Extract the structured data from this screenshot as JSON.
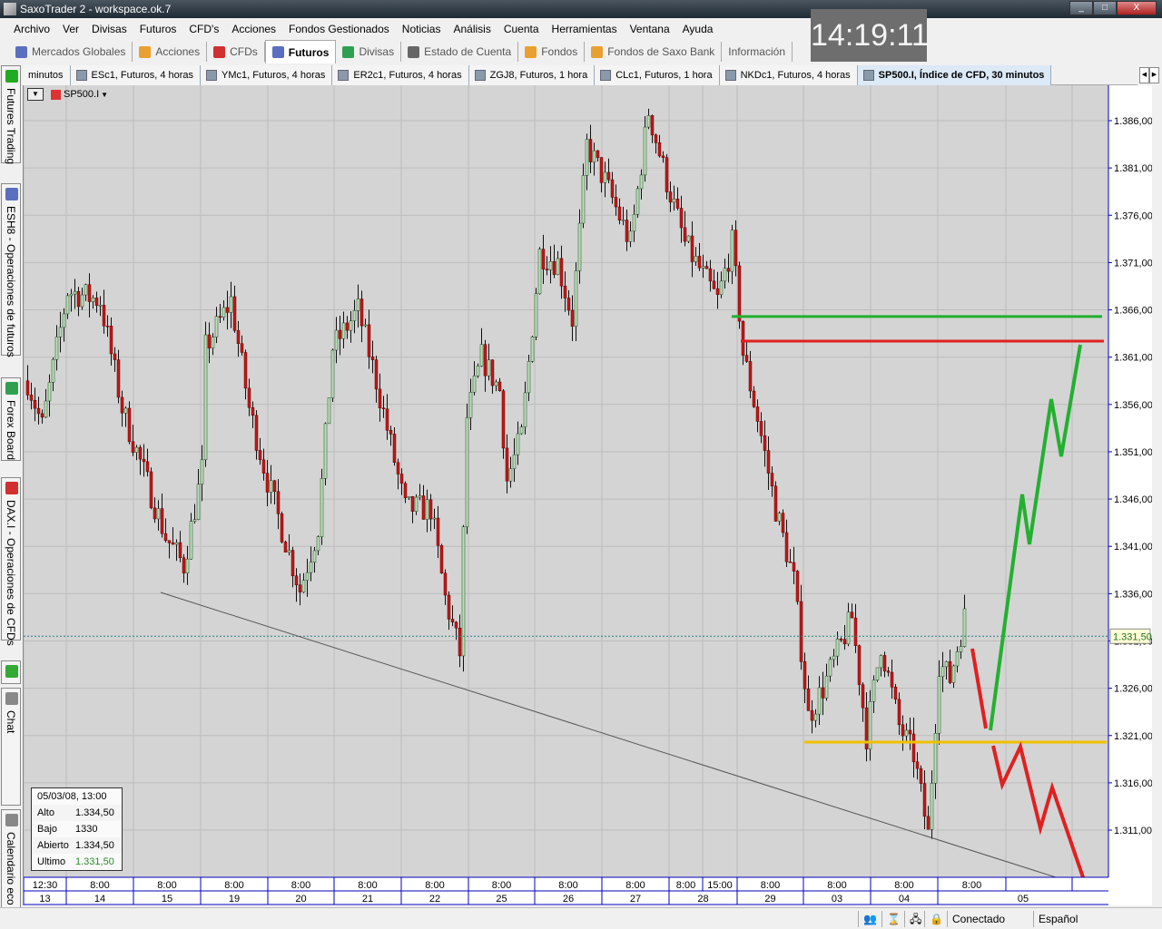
{
  "window": {
    "title": "SaxoTrader 2 - workspace.ok.7",
    "minimize": "_",
    "maximize": "□",
    "close": "X"
  },
  "menu": [
    "Archivo",
    "Ver",
    "Divisas",
    "Futuros",
    "CFD's",
    "Acciones",
    "Fondos Gestionados",
    "Noticias",
    "Análisis",
    "Cuenta",
    "Herramientas",
    "Ventana",
    "Ayuda"
  ],
  "toolbar": [
    {
      "label": "Mercados Globales",
      "color": "#5a6fc0"
    },
    {
      "label": "Acciones",
      "color": "#e8a030"
    },
    {
      "label": "CFDs",
      "color": "#d03030"
    },
    {
      "label": "Futuros",
      "color": "#5a6fc0",
      "active": true
    },
    {
      "label": "Divisas",
      "color": "#30a050"
    },
    {
      "label": "Estado de Cuenta",
      "color": "#666"
    },
    {
      "label": "Fondos",
      "color": "#e8a030"
    },
    {
      "label": "Fondos de Saxo Bank",
      "color": "#e8a030"
    },
    {
      "label": "Información",
      "color": ""
    }
  ],
  "clock": "14:19:11",
  "tabs": [
    "minutos",
    "ESc1, Futuros, 4 horas",
    "YMc1, Futuros, 4 horas",
    "ER2c1, Futuros, 4 horas",
    "ZGJ8, Futuros, 1 hora",
    "CLc1, Futuros, 1 hora",
    "NKDc1, Futuros, 4 horas",
    "SP500.I, Índice de CFD, 30 minutos"
  ],
  "active_tab": 7,
  "sidebar": [
    {
      "label": "Futures Trading",
      "icon": "up-down-arrows-icon",
      "color": "#2a2"
    },
    {
      "label": "ESH8 - Operaciones de futuros",
      "icon": "futures-icon",
      "color": "#5a6fc0"
    },
    {
      "label": "Forex Board",
      "icon": "forex-icon",
      "color": "#30a050"
    },
    {
      "label": "DAX.I - Operaciones de CFDs",
      "icon": "cfd-icon",
      "color": "#d03030"
    },
    {
      "label": "",
      "icon": "chart-icon",
      "color": "#3a3"
    },
    {
      "label": "Chat",
      "icon": "chat-icon",
      "color": "#888"
    },
    {
      "label": "Calendario eco",
      "icon": "calendar-icon",
      "color": "#888"
    }
  ],
  "chart": {
    "symbol": "SP500.I",
    "info": {
      "date": "05/03/08, 13:00",
      "rows": [
        {
          "k": "Alto",
          "v": "1.334,50"
        },
        {
          "k": "Bajo",
          "v": "1330"
        },
        {
          "k": "Abierto",
          "v": "1.334,50"
        },
        {
          "k": "Ultimo",
          "v": "1.331,50"
        }
      ]
    },
    "last_price_label": "1.331,50",
    "colors": {
      "up": "#b8e0b8",
      "down": "#c01818",
      "green_line": "#22b030",
      "red_line": "#e02020",
      "orange_line": "#f0c000"
    }
  },
  "chart_data": {
    "type": "candlestick",
    "ylim": [
      1306,
      1390
    ],
    "yticks": [
      "1.386,00",
      "1.381,00",
      "1.376,00",
      "1.371,00",
      "1.366,00",
      "1.361,00",
      "1.356,00",
      "1.351,00",
      "1.346,00",
      "1.341,00",
      "1.336,00",
      "1.331,00",
      "1.326,00",
      "1.321,00",
      "1.316,00",
      "1.311,00"
    ],
    "ytick_values": [
      1386,
      1381,
      1376,
      1371,
      1366,
      1361,
      1356,
      1351,
      1346,
      1341,
      1336,
      1331,
      1326,
      1321,
      1316,
      1311
    ],
    "last_price": 1331.5,
    "levels": {
      "green": 1365.3,
      "red": 1362.7,
      "orange": 1320.3
    },
    "close_path": [
      [
        0,
        1358.5
      ],
      [
        4,
        1353.7
      ],
      [
        11,
        1368
      ],
      [
        20,
        1367
      ],
      [
        26,
        1355.6
      ],
      [
        38,
        1342
      ],
      [
        43,
        1339
      ],
      [
        48,
        1349
      ],
      [
        49,
        1362
      ],
      [
        56,
        1367
      ],
      [
        61,
        1355.6
      ],
      [
        66,
        1348
      ],
      [
        75,
        1336.4
      ],
      [
        80,
        1343
      ],
      [
        84,
        1362
      ],
      [
        91,
        1366
      ],
      [
        96,
        1358.5
      ],
      [
        104,
        1345
      ],
      [
        111,
        1345
      ],
      [
        115,
        1335.5
      ],
      [
        119,
        1329.7
      ],
      [
        121,
        1354.6
      ],
      [
        125,
        1361
      ],
      [
        130,
        1357.5
      ],
      [
        132,
        1348
      ],
      [
        136,
        1352.7
      ],
      [
        141,
        1372
      ],
      [
        146,
        1371
      ],
      [
        150,
        1365
      ],
      [
        154,
        1383.4
      ],
      [
        159,
        1379.6
      ],
      [
        166,
        1373
      ],
      [
        171,
        1387
      ],
      [
        176,
        1379.6
      ],
      [
        181,
        1373
      ],
      [
        190,
        1367
      ],
      [
        194,
        1373
      ],
      [
        196,
        1365.7
      ],
      [
        197,
        1361.4
      ],
      [
        201,
        1354.6
      ],
      [
        206,
        1345
      ],
      [
        211,
        1337.4
      ],
      [
        215,
        1323
      ],
      [
        219,
        1326
      ],
      [
        227,
        1333.5
      ],
      [
        231,
        1321
      ],
      [
        235,
        1330.7
      ],
      [
        240,
        1322
      ],
      [
        244,
        1319
      ],
      [
        248,
        1310.5
      ],
      [
        251,
        1328.7
      ],
      [
        254,
        1327
      ],
      [
        258,
        1333.5
      ]
    ],
    "time_row": [
      "12:30",
      "8:00",
      "8:00",
      "8:00",
      "8:00",
      "8:00",
      "8:00",
      "8:00",
      "8:00",
      "8:00",
      "8:00",
      "15:00",
      "8:00",
      "8:00",
      "8:00",
      "8:00",
      "",
      ""
    ],
    "date_row": [
      "13",
      "14",
      "15",
      "19",
      "20",
      "21",
      "22",
      "25",
      "26",
      "27",
      "28",
      "29",
      "03",
      "04",
      "05"
    ]
  },
  "status": {
    "connection": "Conectado",
    "language": "Español"
  }
}
